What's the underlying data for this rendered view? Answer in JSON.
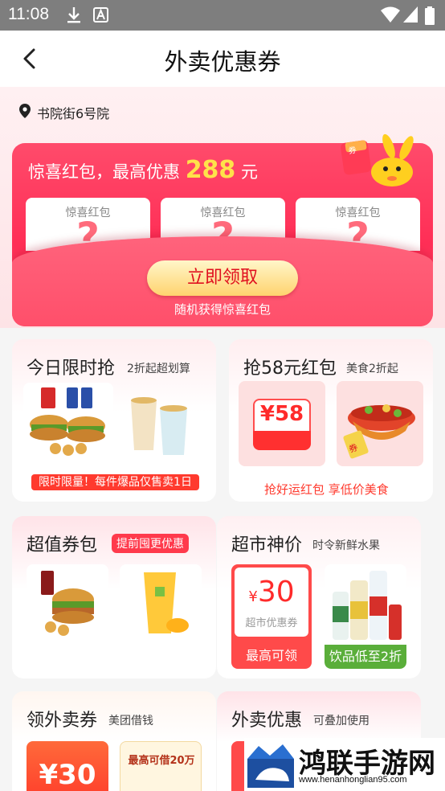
{
  "status_bar": {
    "time": "11:08"
  },
  "header": {
    "title": "外卖优惠券"
  },
  "location": {
    "text": "书院街6号院"
  },
  "surprise": {
    "headline_prefix": "惊喜红包，最高优惠",
    "amount": "288",
    "unit": "元",
    "envelope_labels": [
      "惊喜红包",
      "惊喜红包",
      "惊喜红包"
    ],
    "mystery": "?",
    "mascot_text": "券",
    "claim_button": "立即领取",
    "subtitle": "随机获得惊喜红包"
  },
  "flash": {
    "title": "今日限时抢",
    "tag": "2折起超划算",
    "banner": "限时限量！每件爆品仅售卖1日"
  },
  "grab": {
    "title": "抢58元红包",
    "tag": "美食2折起",
    "coupon": "¥58",
    "stamp": "券",
    "footer": "抢好运红包 享低价美食"
  },
  "value_pack": {
    "title": "超值券包",
    "pill": "提前囤更优惠"
  },
  "supermarket": {
    "title": "超市神价",
    "tag": "时令新鲜水果",
    "coupon_symbol": "¥",
    "coupon_amount": "30",
    "coupon_label": "超市优惠券",
    "coupon_footer": "最高可领",
    "drinks_footer": "饮品低至2折"
  },
  "delivery_coupon": {
    "title": "领外卖券",
    "tag": "美团借钱",
    "amount": "¥30",
    "borrow": "最高可借20万"
  },
  "delivery_discount": {
    "title": "外卖优惠",
    "tag": "可叠加使用"
  },
  "watermark": {
    "name": "鸿联手游网",
    "url": "www.henanhonglian95.com"
  }
}
